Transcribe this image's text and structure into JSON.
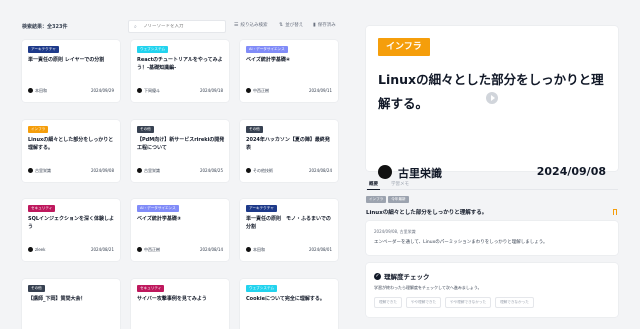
{
  "toolbar": {
    "result_count": "検索結果：全323件",
    "search_placeholder": "フリーワードを入力",
    "filter_label": "絞り込み検索",
    "sort_label": "並び替え",
    "saved_label": "保存済み"
  },
  "cards": [
    {
      "tag": "アーキテクチャ",
      "tag_color": "#1e3a8a",
      "title": "単一責任の原則 レイヤーでの分割",
      "author": "本田和",
      "date": "2024/09/29"
    },
    {
      "tag": "ウェブシステム",
      "tag_color": "#22d3ee",
      "title": "Reactのチュートリアルをやってみよう！-基礎知識編-",
      "author": "下岡優斗",
      "date": "2024/09/18"
    },
    {
      "tag": "AI・データサイエンス",
      "tag_color": "#818cf8",
      "title": "ベイズ統計学基礎④",
      "author": "中西正樹",
      "date": "2024/09/11"
    },
    {
      "tag": "インフラ",
      "tag_color": "#f59e0b",
      "title": "Linuxの細々とした部分をしっかりと理解する。",
      "author": "古里栄識",
      "date": "2024/09/08"
    },
    {
      "tag": "その他",
      "tag_color": "#374151",
      "title": "【PdM向け】新サービスrirekiの開発工程について",
      "author": "古里栄識",
      "date": "2024/08/25"
    },
    {
      "tag": "その他",
      "tag_color": "#374151",
      "title": "2024年ハッカソン【夏の陣】最終発表",
      "author": "その他技術",
      "date": "2024/08/24"
    },
    {
      "tag": "セキュリティ",
      "tag_color": "#be185d",
      "title": "SQLインジェクションを深く体験しよう",
      "author": "zleek",
      "date": "2024/08/21"
    },
    {
      "tag": "AI・データサイエンス",
      "tag_color": "#818cf8",
      "title": "ベイズ統計学基礎③",
      "author": "中西正樹",
      "date": "2024/08/14"
    },
    {
      "tag": "アーキテクチャ",
      "tag_color": "#1e3a8a",
      "title": "単一責任の原則　モノ・ふるまいでの分割",
      "author": "本田和",
      "date": "2024/08/01"
    },
    {
      "tag": "その他",
      "tag_color": "#374151",
      "title": "【講師_下岡】質問大会！",
      "author": "",
      "date": ""
    },
    {
      "tag": "セキュリティ",
      "tag_color": "#be185d",
      "title": "サイバー攻撃事例を見てみよう",
      "author": "",
      "date": ""
    },
    {
      "tag": "ウェブシステム",
      "tag_color": "#22d3ee",
      "title": "Cookieについて完全に理解する。",
      "author": "",
      "date": ""
    }
  ],
  "hero": {
    "tag": "インフラ",
    "title": "Linuxの細々とした部分をしっかりと理解する。",
    "author": "古里栄識",
    "date": "2024/09/08"
  },
  "tabs": {
    "overview": "概要",
    "memo": "学習メモ"
  },
  "detail": {
    "tags": [
      {
        "label": "インフラ",
        "color": "#9ca3af"
      },
      {
        "label": "今年最新",
        "color": "#9ca3af"
      }
    ],
    "title": "Linuxの細々とした部分をしっかりと理解する。",
    "note_meta": "2024/09/08, 古里栄識",
    "note_text": "エンベーダーを通して、Linuxのパーミッションまわりをしっかりと理解しましょう。"
  },
  "check": {
    "title": "理解度チェック",
    "description": "学習が終わったら理解度をチェックして次へ進みましょう。",
    "options": [
      "理解できた",
      "やや理解できた",
      "やや理解できなかった",
      "理解できなかった"
    ]
  }
}
